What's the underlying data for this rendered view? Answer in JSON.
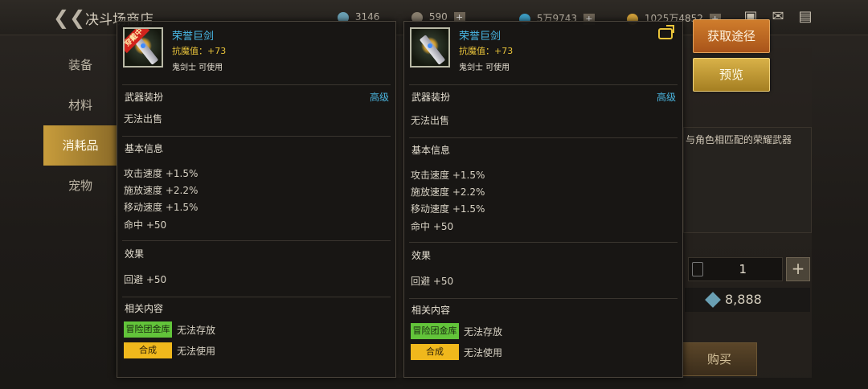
{
  "header": {
    "title": "决斗场商店",
    "currencies": [
      {
        "icon": "gem-icon",
        "value": "3146"
      },
      {
        "icon": "coin-icon",
        "value": "590"
      },
      {
        "icon": "crystal-icon",
        "value": "5万9743"
      },
      {
        "icon": "gold-icon",
        "value": "1025万4852"
      }
    ]
  },
  "categories": [
    "装备",
    "材料",
    "消耗品",
    "宠物"
  ],
  "right_panel": {
    "description": "与角色相匹配的荣耀武器",
    "quantity": "1",
    "price": "8,888",
    "buy_label": "购买",
    "get_route_label": "获取途径",
    "preview_label": "预览"
  },
  "tooltips": [
    {
      "name": "荣誉巨剑",
      "stat": "抗魔值：+73",
      "class_usable": "鬼剑士 可使用",
      "equipped_tag": "穿戴中",
      "section_weapon": "武器装扮",
      "grade": "高级",
      "cannot_sell": "无法出售",
      "section_basic": "基本信息",
      "stats": [
        "攻击速度 +1.5%",
        "施放速度 +2.2%",
        "移动速度 +1.5%",
        "命中 +50"
      ],
      "section_effect": "效果",
      "effect": "回避 +50",
      "section_related": "相关内容",
      "related": [
        {
          "tag": "冒险团金库",
          "text": "无法存放"
        },
        {
          "tag": "合成",
          "text": "无法使用"
        }
      ]
    },
    {
      "name": "荣誉巨剑",
      "stat": "抗魔值：+73",
      "class_usable": "鬼剑士 可使用",
      "section_weapon": "武器装扮",
      "grade": "高级",
      "cannot_sell": "无法出售",
      "section_basic": "基本信息",
      "stats": [
        "攻击速度 +1.5%",
        "施放速度 +2.2%",
        "移动速度 +1.5%",
        "命中 +50"
      ],
      "section_effect": "效果",
      "effect": "回避 +50",
      "section_related": "相关内容",
      "related": [
        {
          "tag": "冒险团金库",
          "text": "无法存放"
        },
        {
          "tag": "合成",
          "text": "无法使用"
        }
      ]
    }
  ],
  "colors": {
    "item_name": "#49b8e6",
    "stat_yellow": "#e8c33a",
    "grade_blue": "#4ab4de",
    "tag_green": "#62c43a",
    "tag_yellow": "#f0b81c"
  }
}
